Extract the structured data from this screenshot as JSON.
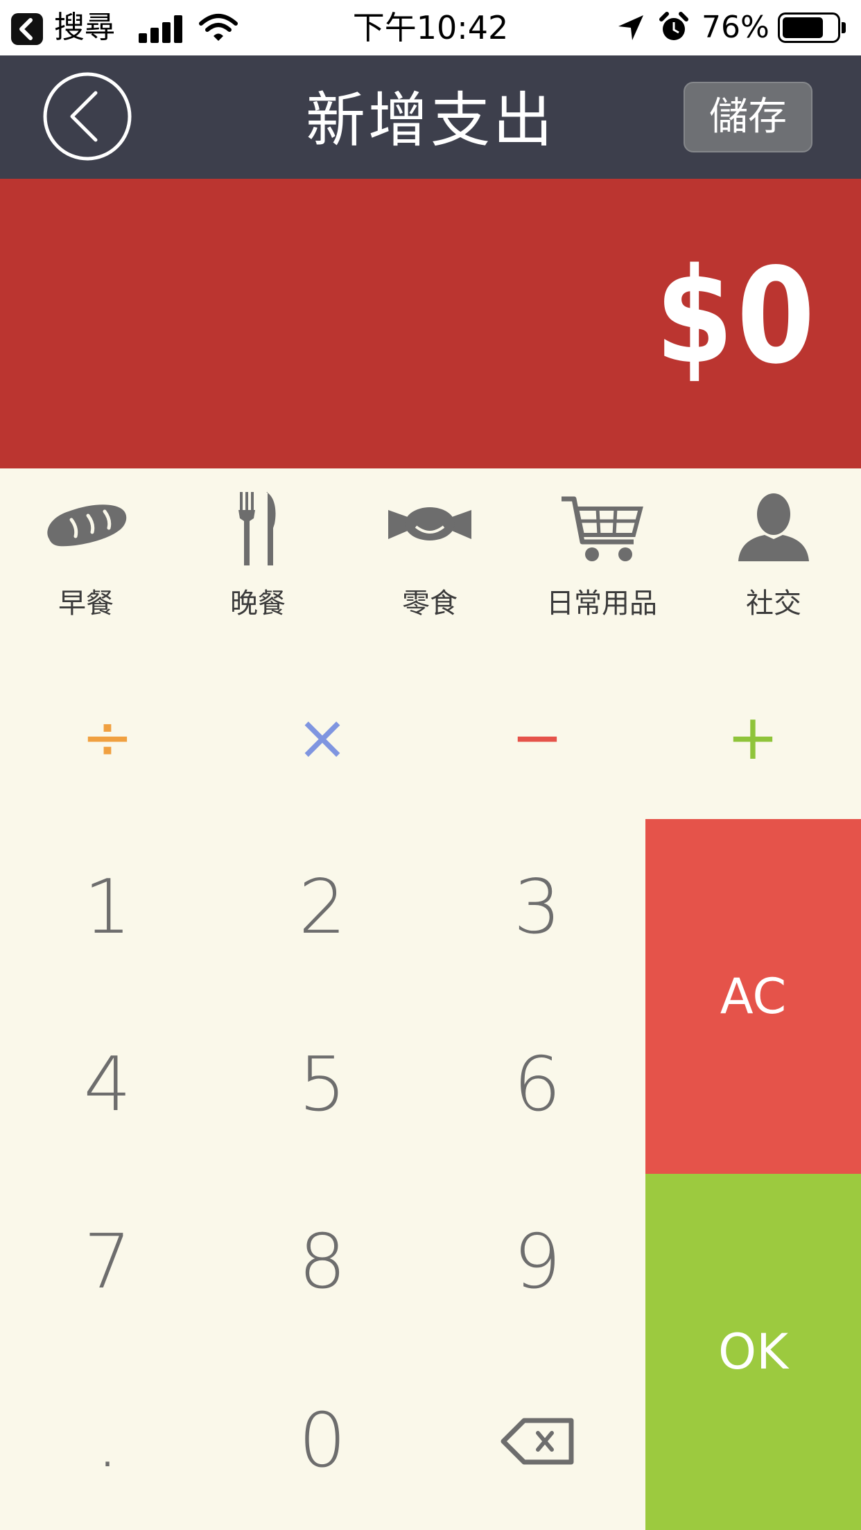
{
  "status_bar": {
    "back_app": "搜尋",
    "time": "下午10:42",
    "battery_percent": "76%",
    "battery_level": 0.76
  },
  "nav": {
    "title": "新增支出",
    "save_label": "儲存"
  },
  "amount": {
    "display": "$0",
    "color": "#bb3530"
  },
  "categories": [
    {
      "label": "早餐",
      "icon": "bread-icon"
    },
    {
      "label": "晚餐",
      "icon": "fork-knife-icon"
    },
    {
      "label": "零食",
      "icon": "candy-icon"
    },
    {
      "label": "日常用品",
      "icon": "shopping-cart-icon"
    },
    {
      "label": "社交",
      "icon": "person-icon"
    }
  ],
  "operators": [
    {
      "label": "÷",
      "color": "#f0a040"
    },
    {
      "label": "×",
      "color": "#7f95e0"
    },
    {
      "label": "−",
      "color": "#e5534a"
    },
    {
      "label": "+",
      "color": "#8fc43a"
    }
  ],
  "keypad": {
    "k1": "1",
    "k2": "2",
    "k3": "3",
    "k4": "4",
    "k5": "5",
    "k6": "6",
    "k7": "7",
    "k8": "8",
    "k9": "9",
    "dot": ".",
    "k0": "0",
    "backspace_icon": "backspace-icon"
  },
  "actions": {
    "clear_label": "AC",
    "clear_color": "#e5534a",
    "ok_label": "OK",
    "ok_color": "#9cca3f"
  }
}
